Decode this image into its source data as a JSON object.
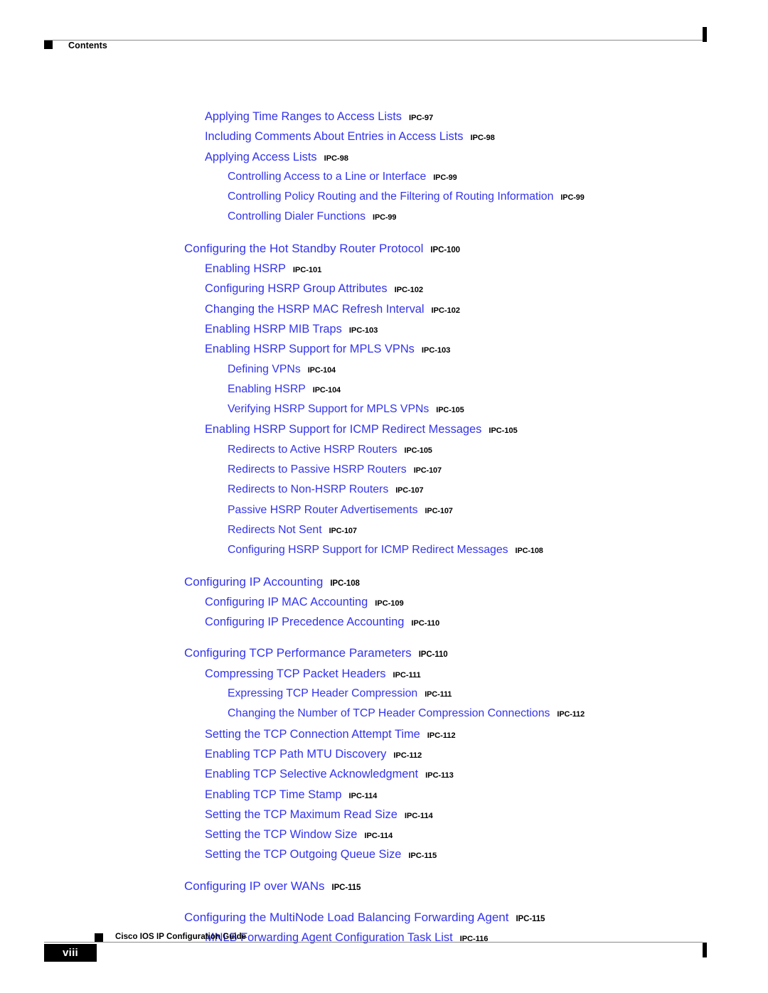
{
  "header": {
    "marker_icon": "black-square-icon",
    "title": "Contents"
  },
  "footer": {
    "page_number": "viii",
    "marker_icon": "black-square-icon",
    "document_title": "Cisco IOS IP Configuration Guide"
  },
  "colors": {
    "entry_link": "#3333EE",
    "page_number": "#000000",
    "rule": "#8A8A8A",
    "marker": "#000000"
  },
  "toc": {
    "entries": [
      {
        "level": 2,
        "title": "Applying Time Ranges to Access Lists",
        "page": "IPC-97",
        "gap_before": false
      },
      {
        "level": 2,
        "title": "Including Comments About Entries in Access Lists",
        "page": "IPC-98",
        "gap_before": false
      },
      {
        "level": 2,
        "title": "Applying Access Lists",
        "page": "IPC-98",
        "gap_before": false
      },
      {
        "level": 3,
        "title": "Controlling Access to a Line or Interface",
        "page": "IPC-99",
        "gap_before": false
      },
      {
        "level": 3,
        "title": "Controlling Policy Routing and the Filtering of Routing Information",
        "page": "IPC-99",
        "gap_before": false
      },
      {
        "level": 3,
        "title": "Controlling Dialer Functions",
        "page": "IPC-99",
        "gap_before": false
      },
      {
        "level": 1,
        "title": "Configuring the Hot Standby Router Protocol",
        "page": "IPC-100",
        "gap_before": true
      },
      {
        "level": 2,
        "title": "Enabling HSRP",
        "page": "IPC-101",
        "gap_before": false
      },
      {
        "level": 2,
        "title": "Configuring HSRP Group Attributes",
        "page": "IPC-102",
        "gap_before": false
      },
      {
        "level": 2,
        "title": "Changing the HSRP MAC Refresh Interval",
        "page": "IPC-102",
        "gap_before": false
      },
      {
        "level": 2,
        "title": "Enabling HSRP MIB Traps",
        "page": "IPC-103",
        "gap_before": false
      },
      {
        "level": 2,
        "title": "Enabling HSRP Support for MPLS VPNs",
        "page": "IPC-103",
        "gap_before": false
      },
      {
        "level": 3,
        "title": "Defining VPNs",
        "page": "IPC-104",
        "gap_before": false
      },
      {
        "level": 3,
        "title": "Enabling HSRP",
        "page": "IPC-104",
        "gap_before": false
      },
      {
        "level": 3,
        "title": "Verifying HSRP Support for MPLS VPNs",
        "page": "IPC-105",
        "gap_before": false
      },
      {
        "level": 2,
        "title": "Enabling HSRP Support for ICMP Redirect Messages",
        "page": "IPC-105",
        "gap_before": false
      },
      {
        "level": 3,
        "title": "Redirects to Active HSRP Routers",
        "page": "IPC-105",
        "gap_before": false
      },
      {
        "level": 3,
        "title": "Redirects to Passive HSRP Routers",
        "page": "IPC-107",
        "gap_before": false
      },
      {
        "level": 3,
        "title": "Redirects to Non-HSRP Routers",
        "page": "IPC-107",
        "gap_before": false
      },
      {
        "level": 3,
        "title": "Passive HSRP Router Advertisements",
        "page": "IPC-107",
        "gap_before": false
      },
      {
        "level": 3,
        "title": "Redirects Not Sent",
        "page": "IPC-107",
        "gap_before": false
      },
      {
        "level": 3,
        "title": "Configuring HSRP Support for ICMP Redirect Messages",
        "page": "IPC-108",
        "gap_before": false
      },
      {
        "level": 1,
        "title": "Configuring IP Accounting",
        "page": "IPC-108",
        "gap_before": true
      },
      {
        "level": 2,
        "title": "Configuring IP MAC Accounting",
        "page": "IPC-109",
        "gap_before": false
      },
      {
        "level": 2,
        "title": "Configuring IP Precedence Accounting",
        "page": "IPC-110",
        "gap_before": false
      },
      {
        "level": 1,
        "title": "Configuring TCP Performance Parameters",
        "page": "IPC-110",
        "gap_before": true
      },
      {
        "level": 2,
        "title": "Compressing TCP Packet Headers",
        "page": "IPC-111",
        "gap_before": false
      },
      {
        "level": 3,
        "title": "Expressing TCP Header Compression",
        "page": "IPC-111",
        "gap_before": false
      },
      {
        "level": 3,
        "title": "Changing the Number of TCP Header Compression Connections",
        "page": "IPC-112",
        "gap_before": false
      },
      {
        "level": 2,
        "title": "Setting the TCP Connection Attempt Time",
        "page": "IPC-112",
        "gap_before": false
      },
      {
        "level": 2,
        "title": "Enabling TCP Path MTU Discovery",
        "page": "IPC-112",
        "gap_before": false
      },
      {
        "level": 2,
        "title": "Enabling TCP Selective Acknowledgment",
        "page": "IPC-113",
        "gap_before": false
      },
      {
        "level": 2,
        "title": "Enabling TCP Time Stamp",
        "page": "IPC-114",
        "gap_before": false
      },
      {
        "level": 2,
        "title": "Setting the TCP Maximum Read Size",
        "page": "IPC-114",
        "gap_before": false
      },
      {
        "level": 2,
        "title": "Setting the TCP Window Size",
        "page": "IPC-114",
        "gap_before": false
      },
      {
        "level": 2,
        "title": "Setting the TCP Outgoing Queue Size",
        "page": "IPC-115",
        "gap_before": false
      },
      {
        "level": 1,
        "title": "Configuring IP over WANs",
        "page": "IPC-115",
        "gap_before": true
      },
      {
        "level": 1,
        "title": "Configuring the MultiNode Load Balancing Forwarding Agent",
        "page": "IPC-115",
        "gap_before": true
      },
      {
        "level": 2,
        "title": "MNLB Forwarding Agent Configuration Task List",
        "page": "IPC-116",
        "gap_before": false
      }
    ]
  }
}
